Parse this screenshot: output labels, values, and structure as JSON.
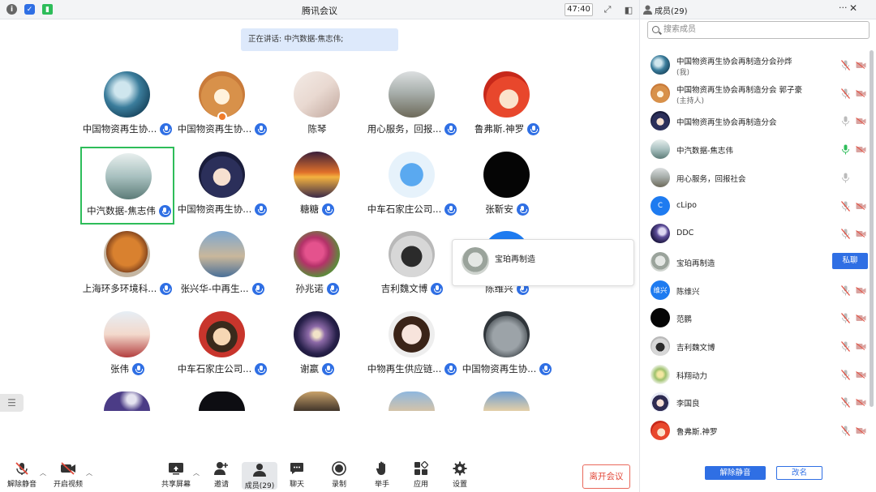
{
  "window": {
    "title": "腾讯会议",
    "timer": "47:40"
  },
  "speaking_banner": "正在讲话: 中汽数据-焦志伟;",
  "participants": [
    {
      "name": "中国物资再生协...",
      "avatar": "ocean-wave"
    },
    {
      "name": "中国物资再生协...",
      "avatar": "shiba-dog"
    },
    {
      "name": "陈琴",
      "avatar": "pink-blossom"
    },
    {
      "name": "用心服务，回报...",
      "avatar": "lake-shore"
    },
    {
      "name": "鲁弗斯.神罗",
      "avatar": "cartoon-red"
    },
    {
      "name": "中汽数据-焦志伟",
      "avatar": "misty-lake"
    },
    {
      "name": "中国物资再生协...",
      "avatar": "anime-boy"
    },
    {
      "name": "糖糖",
      "avatar": "sunset"
    },
    {
      "name": "中车石家庄公司...",
      "avatar": "pocoyo"
    },
    {
      "name": "张靳安",
      "avatar": "black"
    },
    {
      "name": "上海环多环境科...",
      "avatar": "autumn-tree"
    },
    {
      "name": "张兴华-中再生...",
      "avatar": "bridge"
    },
    {
      "name": "孙兆诺",
      "avatar": "flowers"
    },
    {
      "name": "吉利魏文博",
      "avatar": "car-toy"
    },
    {
      "name": "陈维兴",
      "avatar": "blue"
    },
    {
      "name": "张伟",
      "avatar": "family"
    },
    {
      "name": "中车石家庄公司...",
      "avatar": "cartoon-girl"
    },
    {
      "name": "谢嬴",
      "avatar": "galaxy"
    },
    {
      "name": "中物再生供应链...",
      "avatar": "woman"
    },
    {
      "name": "中国物资再生协...",
      "avatar": "cat"
    }
  ],
  "popup": {
    "name": "宝珀再制造"
  },
  "toolbar": {
    "unmute": "解除静音",
    "start_video": "开启视频",
    "share_screen": "共享屏幕",
    "invite": "邀请",
    "members": "成员(29)",
    "chat": "聊天",
    "record": "录制",
    "raise_hand": "举手",
    "apps": "应用",
    "settings": "设置",
    "leave": "离开会议"
  },
  "panel": {
    "title": "成员(29)",
    "search_placeholder": "搜索成员",
    "chat_label": "私聊",
    "unmute_all": "解除静音",
    "rename": "改名",
    "members": [
      {
        "name": "中国物资再生协会再制造分会孙烨",
        "sub": "(我)",
        "avatar": "ocean-wave",
        "mic": "muted",
        "cam": "off"
      },
      {
        "name": "中国物资再生协会再制造分会 郭子豪",
        "sub": "(主持人)",
        "avatar": "shiba-dog",
        "mic": "muted",
        "cam": "off"
      },
      {
        "name": "中国物资再生协会再制造分会",
        "sub": "",
        "avatar": "anime-boy",
        "mic": "on",
        "cam": "off"
      },
      {
        "name": "中汽数据-焦志伟",
        "sub": "",
        "avatar": "misty-lake",
        "mic": "speaking",
        "cam": "off"
      },
      {
        "name": "用心服务，回报社会",
        "sub": "",
        "avatar": "lake-shore",
        "mic": "on",
        "cam": "none"
      },
      {
        "name": "cLipo",
        "sub": "",
        "avatar": "letter-c",
        "initial": "C",
        "mic": "muted",
        "cam": "off"
      },
      {
        "name": "DDC",
        "sub": "",
        "avatar": "moon",
        "mic": "muted",
        "cam": "off"
      },
      {
        "name": "宝珀再制造",
        "sub": "",
        "avatar": "coin",
        "mic": "chat",
        "cam": "chat"
      },
      {
        "name": "陈维兴",
        "sub": "",
        "avatar": "initial-blue",
        "initial": "维兴",
        "mic": "muted",
        "cam": "off"
      },
      {
        "name": "范鹏",
        "sub": "",
        "avatar": "black",
        "mic": "muted",
        "cam": "off"
      },
      {
        "name": "吉利魏文博",
        "sub": "",
        "avatar": "car-toy",
        "mic": "muted",
        "cam": "off"
      },
      {
        "name": "科翔动力",
        "sub": "",
        "avatar": "flowers-green",
        "mic": "muted",
        "cam": "off"
      },
      {
        "name": "李国良",
        "sub": "",
        "avatar": "anime-girl",
        "mic": "muted",
        "cam": "off"
      },
      {
        "name": "鲁弗斯.神罗",
        "sub": "",
        "avatar": "cartoon-red",
        "mic": "muted",
        "cam": "off"
      }
    ]
  },
  "colors": {
    "accent": "#2f6fe4",
    "active_border": "#2ebd5a",
    "muted_red": "#e24a3b",
    "banner_bg": "#dde9fb"
  }
}
